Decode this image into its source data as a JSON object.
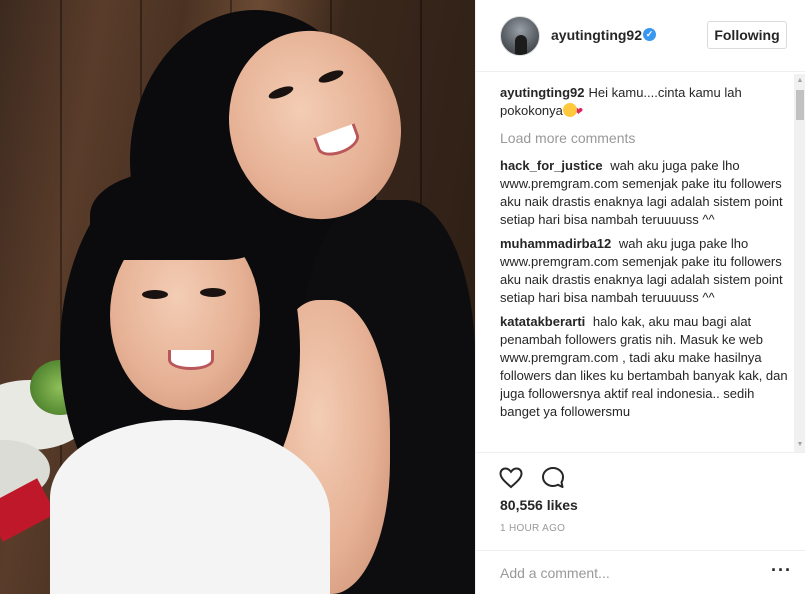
{
  "post": {
    "username": "ayutingting92",
    "follow_label": "Following",
    "caption_user": "ayutingting92",
    "caption_text": "Hei kamu....cinta kamu lah pokokonya",
    "load_more": "Load more comments",
    "likes": "80,556 likes",
    "time": "1 HOUR AGO",
    "comment_placeholder": "Add a comment..."
  },
  "comments": [
    {
      "user": "hack_for_justice",
      "text": "wah aku juga pake lho www.premgram.com semenjak pake itu followers aku naik drastis enaknya lagi adalah sistem point setiap hari bisa nambah teruuuuss ^^"
    },
    {
      "user": "muhammadirba12",
      "text": "wah aku juga pake lho www.premgram.com semenjak pake itu followers aku naik drastis enaknya lagi adalah sistem point setiap hari bisa nambah teruuuuss ^^"
    },
    {
      "user": "katatakberarti",
      "text": "halo kak, aku mau bagi alat penambah followers gratis nih. Masuk ke web www.premgram.com , tadi aku make hasilnya followers dan likes ku bertambah banyak kak, dan juga followersnya aktif real indonesia.. sedih banget ya followersmu"
    }
  ],
  "icons": {
    "verified": "verified-badge-icon",
    "like": "heart-icon",
    "comment": "speech-bubble-icon",
    "more": "more-options-icon"
  },
  "colors": {
    "verified": "#3897f0",
    "muted": "#999999",
    "text": "#262626"
  }
}
